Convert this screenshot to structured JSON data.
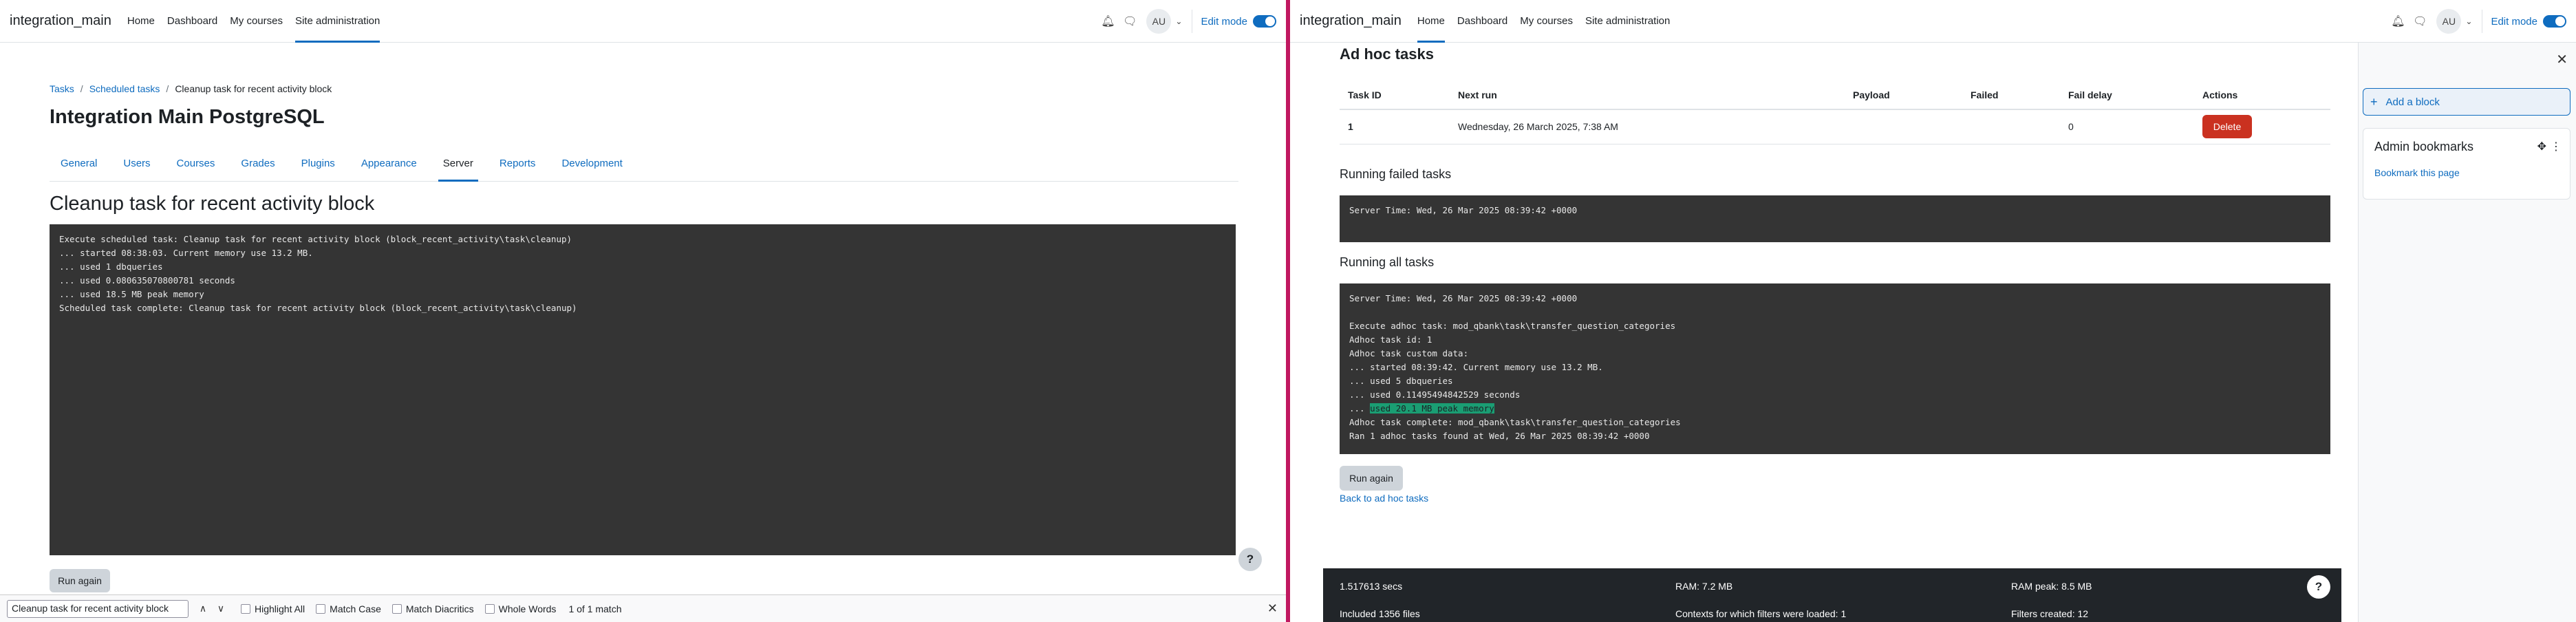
{
  "navbar": {
    "brand": "integration_main",
    "links": [
      "Home",
      "Dashboard",
      "My courses",
      "Site administration"
    ],
    "avatar_initials": "AU",
    "edit_mode_label": "Edit mode",
    "icons": [
      "bell-icon",
      "chat-icon",
      "chevron-down-icon"
    ]
  },
  "left": {
    "breadcrumb": [
      "Tasks",
      "Scheduled tasks",
      "Cleanup task for recent activity block"
    ],
    "page_title": "Integration Main PostgreSQL",
    "tabs": [
      "General",
      "Users",
      "Courses",
      "Grades",
      "Plugins",
      "Appearance",
      "Server",
      "Reports",
      "Development"
    ],
    "active_tab": "Server",
    "task_heading": "Cleanup task for recent activity block",
    "console_lines": [
      "Execute scheduled task: Cleanup task for recent activity block (block_recent_activity\\task\\cleanup)",
      "... started 08:38:03. Current memory use 13.2 MB.",
      "... used 1 dbqueries",
      "... used 0.080635070800781 seconds",
      "... used 18.5 MB peak memory",
      "Scheduled task complete: Cleanup task for recent activity block (block_recent_activity\\task\\cleanup)"
    ],
    "run_again": "Run again",
    "help": "?"
  },
  "findbar": {
    "query": "Cleanup task for recent activity block",
    "up": "∧",
    "down": "∨",
    "highlight_all": "Highlight All",
    "match_case": "Match Case",
    "match_diacritics": "Match Diacritics",
    "whole_words": "Whole Words",
    "status": "1 of 1 match",
    "close": "✕"
  },
  "right": {
    "heading": "Ad hoc tasks",
    "table": {
      "headers": [
        "Task ID",
        "Next run",
        "Payload",
        "Failed",
        "Fail delay",
        "Actions"
      ],
      "rows": [
        {
          "id": "1",
          "next_run": "Wednesday, 26 March 2025, 7:38 AM",
          "payload": "",
          "failed": "",
          "fail_delay": "0",
          "action": "Delete"
        }
      ]
    },
    "running_failed_title": "Running failed tasks",
    "failed_console": [
      "Server Time: Wed, 26 Mar 2025 08:39:42 +0000"
    ],
    "running_all_title": "Running all tasks",
    "all_console": {
      "before": [
        "Server Time: Wed, 26 Mar 2025 08:39:42 +0000",
        "",
        "Execute adhoc task: mod_qbank\\task\\transfer_question_categories",
        "Adhoc task id: 1",
        "Adhoc task custom data:",
        "... started 08:39:42. Current memory use 13.2 MB.",
        "... used 5 dbqueries",
        "... used 0.11495494842529 seconds"
      ],
      "highlight_prefix": "... ",
      "highlight": "used 20.1 MB peak memory",
      "after": [
        "Adhoc task complete: mod_qbank\\task\\transfer_question_categories",
        "Ran 1 adhoc tasks found at Wed, 26 Mar 2025 08:39:42 +0000"
      ]
    },
    "run_again": "Run again",
    "back_link": "Back to ad hoc tasks",
    "drawer": {
      "close": "✕",
      "add_block": "Add a block",
      "block_title": "Admin bookmarks",
      "bookmark_link": "Bookmark this page"
    },
    "footer": {
      "time": "1.517613 secs",
      "ram": "RAM: 7.2 MB",
      "ram_peak": "RAM peak: 8.5 MB",
      "included": "Included 1356 files",
      "contexts": "Contexts for which filters were loaded: 1",
      "filters": "Filters created: 12"
    },
    "help": "?"
  }
}
